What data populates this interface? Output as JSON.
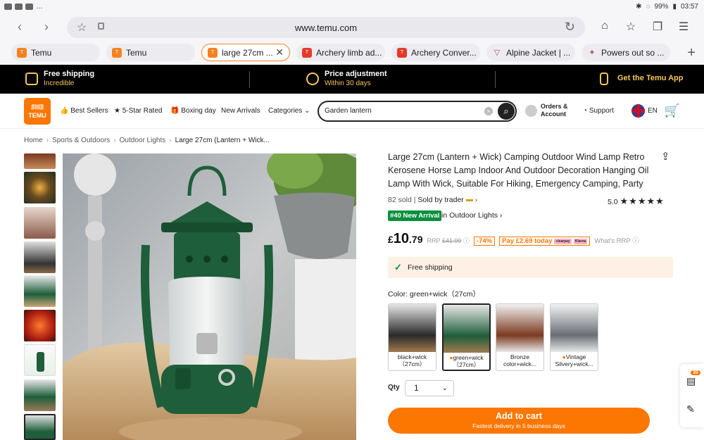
{
  "status_bar": {
    "left_icons": [
      "mail-icon",
      "youtube-icon",
      "youtube-icon",
      "more-icon"
    ],
    "battery": "99%",
    "time": "03:57"
  },
  "browser": {
    "url": "www.temu.com",
    "tabs": [
      {
        "label": "Temu",
        "icon": "temu-icon",
        "active": false
      },
      {
        "label": "Temu",
        "icon": "temu-icon",
        "active": false
      },
      {
        "label": "large 27cm ...",
        "icon": "temu-icon",
        "active": true
      },
      {
        "label": "Archery limb ad...",
        "icon": "temu-icon",
        "active": false
      },
      {
        "label": "Archery Conver...",
        "icon": "temu-icon",
        "active": false
      },
      {
        "label": "Alpine Jacket | ...",
        "icon": "alpine-icon",
        "active": false
      },
      {
        "label": "Powers out so ...",
        "icon": "powers-icon",
        "active": false
      }
    ]
  },
  "promo": {
    "free_shipping": "Free shipping",
    "free_shipping_sub": "Incredible",
    "price_adjust": "Price adjustment",
    "price_adjust_sub": "Within 30 days",
    "app": "Get the Temu App"
  },
  "header": {
    "logo_top": "ꕷꔖꖸ",
    "logo": "TEMU",
    "best_sellers": "Best Sellers",
    "five_star": "5-Star Rated",
    "boxing_day": "Boxing day",
    "new_arrivals": "New Arrivals",
    "categories": "Categories",
    "search_value": "Garden lantern",
    "orders_line1": "Orders &",
    "orders_line2": "Account",
    "support": "Support",
    "lang": "EN"
  },
  "breadcrumb": {
    "home": "Home",
    "sports": "Sports & Outdoors",
    "lights": "Outdoor Lights",
    "current": "Large 27cm (Lantern + Wick..."
  },
  "product": {
    "title": "Large 27cm (Lantern + Wick) Camping Outdoor Wind Lamp Retro Kerosene Horse Lamp Indoor And Outdoor Decoration Hanging Oil Lamp With Wick, Suitable For Hiking, Emergency Camping, Party",
    "sold": "82 sold",
    "sold_by": "Sold by trader",
    "rating": "5.0",
    "stars": "★★★★★",
    "new_badge": "#40 New Arrival",
    "in_category_prefix": "in",
    "in_category": "Outdoor Lights",
    "price_currency": "£",
    "price_whole": "10",
    "price_frac": ".79",
    "rrp_label": "RRP",
    "rrp": "£41.99",
    "discount": "-74%",
    "pay_today": "Pay £2.69 today",
    "klarna1": "clearpay",
    "klarna2": "Klarna",
    "whats_rrp": "What's RRP",
    "free_shipping": "Free shipping",
    "color_label": "Color: green+wick（27cm）",
    "swatches": [
      {
        "line1": "black+wick",
        "line2": "（27cm）",
        "selected": false
      },
      {
        "line1": "green+wick",
        "line2": "（27cm）",
        "selected": true
      },
      {
        "line1": "Bronze",
        "line2": "color+wick...",
        "selected": false
      },
      {
        "line1": "Vintage",
        "line2": "Silvery+wick...",
        "selected": false
      }
    ],
    "qty_label": "Qty",
    "qty_value": "1",
    "add_to_cart": "Add to cart",
    "delivery": "Fastest delivery in 5 business days"
  },
  "side_widget": {
    "count": "30"
  },
  "colors": {
    "brand": "#fb7701",
    "lantern_green": "#1e5e3a",
    "promo_accent": "#f5c75a",
    "new_badge": "#0a8f3d"
  }
}
